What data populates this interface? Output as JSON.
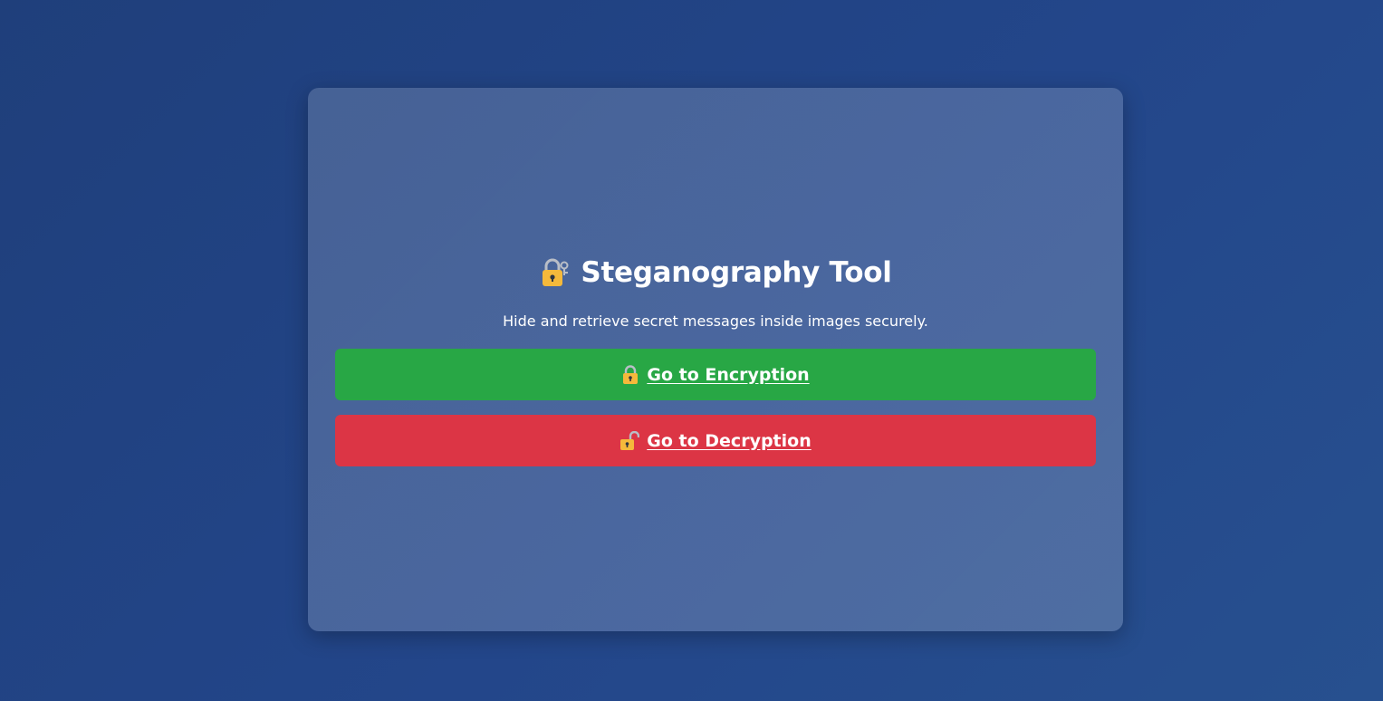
{
  "app": {
    "title": "Steganography Tool",
    "title_icon": "lock-with-key-icon",
    "subtitle": "Hide and retrieve secret messages inside images securely."
  },
  "actions": {
    "encrypt": {
      "label": "Go to Encryption",
      "icon": "closed-lock-icon",
      "color": "#28a745"
    },
    "decrypt": {
      "label": "Go to Decryption",
      "icon": "open-lock-icon",
      "color": "#dc3545"
    }
  },
  "colors": {
    "lock_gold": "#f5b93b"
  }
}
